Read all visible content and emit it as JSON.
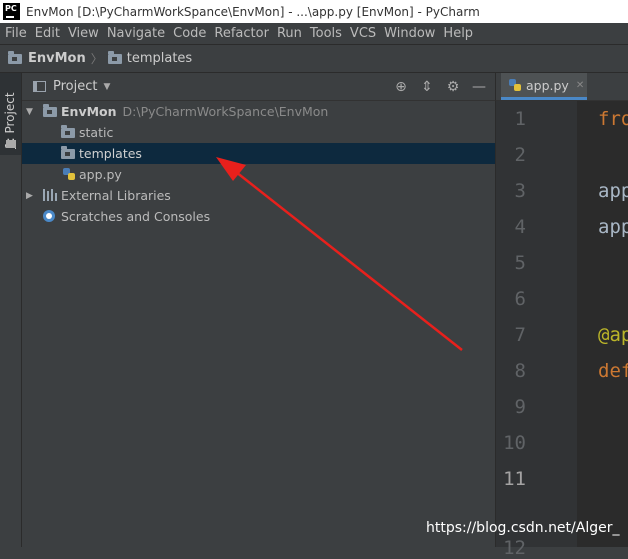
{
  "window": {
    "title": "EnvMon [D:\\PyCharmWorkSpance\\EnvMon] - ...\\app.py [EnvMon] - PyCharm",
    "app_icon": "pycharm-logo-icon",
    "app_icon_text": "PC"
  },
  "menu": [
    "File",
    "Edit",
    "View",
    "Navigate",
    "Code",
    "Refactor",
    "Run",
    "Tools",
    "VCS",
    "Window",
    "Help"
  ],
  "navbar": {
    "root": "EnvMon",
    "child": "templates"
  },
  "tool_strip": {
    "number": "1",
    "label": ": Project"
  },
  "project_panel": {
    "title": "Project",
    "tree": {
      "root": {
        "name": "EnvMon",
        "path": "D:\\PyCharmWorkSpance\\EnvMon"
      },
      "children": [
        "static",
        "templates",
        "app.py"
      ],
      "selected": "templates",
      "external": "External Libraries",
      "scratches": "Scratches and Consoles"
    }
  },
  "editor": {
    "tab": "app.py",
    "line_numbers": [
      "1",
      "2",
      "3",
      "4",
      "5",
      "6",
      "7",
      "8",
      "9",
      "10",
      "11",
      "12"
    ],
    "current_line": "11",
    "lines": {
      "l1": "fro",
      "l3": "app",
      "l4": "app",
      "l7": "@ap",
      "l8": "def"
    }
  },
  "colors": {
    "annotation_arrow": "#e8201c",
    "selection": "#0d293e",
    "tab_underline": "#4a88c7"
  },
  "watermark": "https://blog.csdn.net/Alger_"
}
